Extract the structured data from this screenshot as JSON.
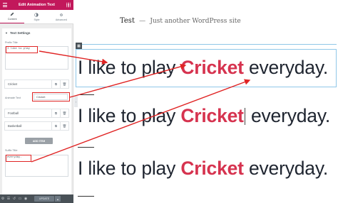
{
  "panel": {
    "title": "Edit Animation Text",
    "tabs": [
      {
        "label": "Content",
        "icon": "pencil-icon"
      },
      {
        "label": "Style",
        "icon": "half-circle-icon"
      },
      {
        "label": "Advanced",
        "icon": "gear-icon"
      }
    ],
    "section_title": "Text Settings",
    "prefix_label": "Prefix Title",
    "prefix_value": "I like to play",
    "items": [
      {
        "label": "Cricket"
      },
      {
        "label": "Football"
      },
      {
        "label": "Basketball"
      }
    ],
    "animate_text_label": "Animate Text",
    "animate_text_value": "Cricket",
    "add_item_label": "ADD ITEM",
    "suffix_label": "Suffix Title",
    "suffix_value": "everyday.",
    "footer_update": "UPDATE"
  },
  "preview": {
    "site_name": "Test",
    "separator": "—",
    "tagline": "Just another WordPress site",
    "lines": [
      {
        "prefix": "I like to play",
        "highlight": "Cricket",
        "suffix": "everyday."
      },
      {
        "prefix": "I like to play",
        "highlight": "Cricket",
        "suffix": "everyday."
      },
      {
        "prefix": "I like to play",
        "highlight": "Cricket",
        "suffix": "everyday."
      }
    ]
  },
  "colors": {
    "brand": "#c2185b",
    "highlight": "#d6334f",
    "annotation": "#e02424"
  }
}
